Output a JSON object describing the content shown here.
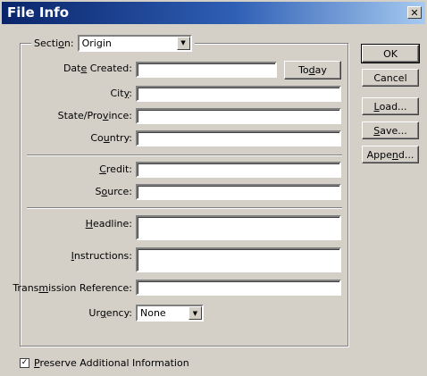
{
  "window": {
    "title": "File Info",
    "close_glyph": "✕"
  },
  "section": {
    "label_pre": "Secti",
    "label_key": "o",
    "label_post": "n:",
    "value": "Origin"
  },
  "fields": {
    "date_created": {
      "pre": "Dat",
      "key": "e",
      "post": " Created:",
      "value": ""
    },
    "city": {
      "pre": "Cit",
      "key": "y",
      "post": ":",
      "value": ""
    },
    "state": {
      "pre": "State/Pro",
      "key": "v",
      "post": "ince:",
      "value": ""
    },
    "country": {
      "pre": "Co",
      "key": "u",
      "post": "ntry:",
      "value": ""
    },
    "credit": {
      "pre": "",
      "key": "C",
      "post": "redit:",
      "value": ""
    },
    "source": {
      "pre": "S",
      "key": "o",
      "post": "urce:",
      "value": ""
    },
    "headline": {
      "pre": "",
      "key": "H",
      "post": "eadline:",
      "value": ""
    },
    "instructions": {
      "pre": "",
      "key": "I",
      "post": "nstructions:",
      "value": ""
    },
    "transmission": {
      "pre": "Trans",
      "key": "m",
      "post": "ission Reference:",
      "value": ""
    },
    "urgency": {
      "pre": "Ur",
      "key": "g",
      "post": "ency:",
      "value": "None"
    }
  },
  "buttons": {
    "today": {
      "pre": "To",
      "key": "d",
      "post": "ay"
    },
    "ok": {
      "label": "OK"
    },
    "cancel": {
      "label": "Cancel"
    },
    "load": {
      "pre": "",
      "key": "L",
      "post": "oad..."
    },
    "save": {
      "pre": "",
      "key": "S",
      "post": "ave..."
    },
    "append": {
      "pre": "Appe",
      "key": "n",
      "post": "d..."
    }
  },
  "preserve": {
    "pre": "",
    "key": "P",
    "post": "reserve Additional Information",
    "checked": true,
    "check_glyph": "✓"
  },
  "colors": {
    "titlebar_start": "#0a246a",
    "titlebar_end": "#a6caf0",
    "face": "#d4d0c8"
  }
}
